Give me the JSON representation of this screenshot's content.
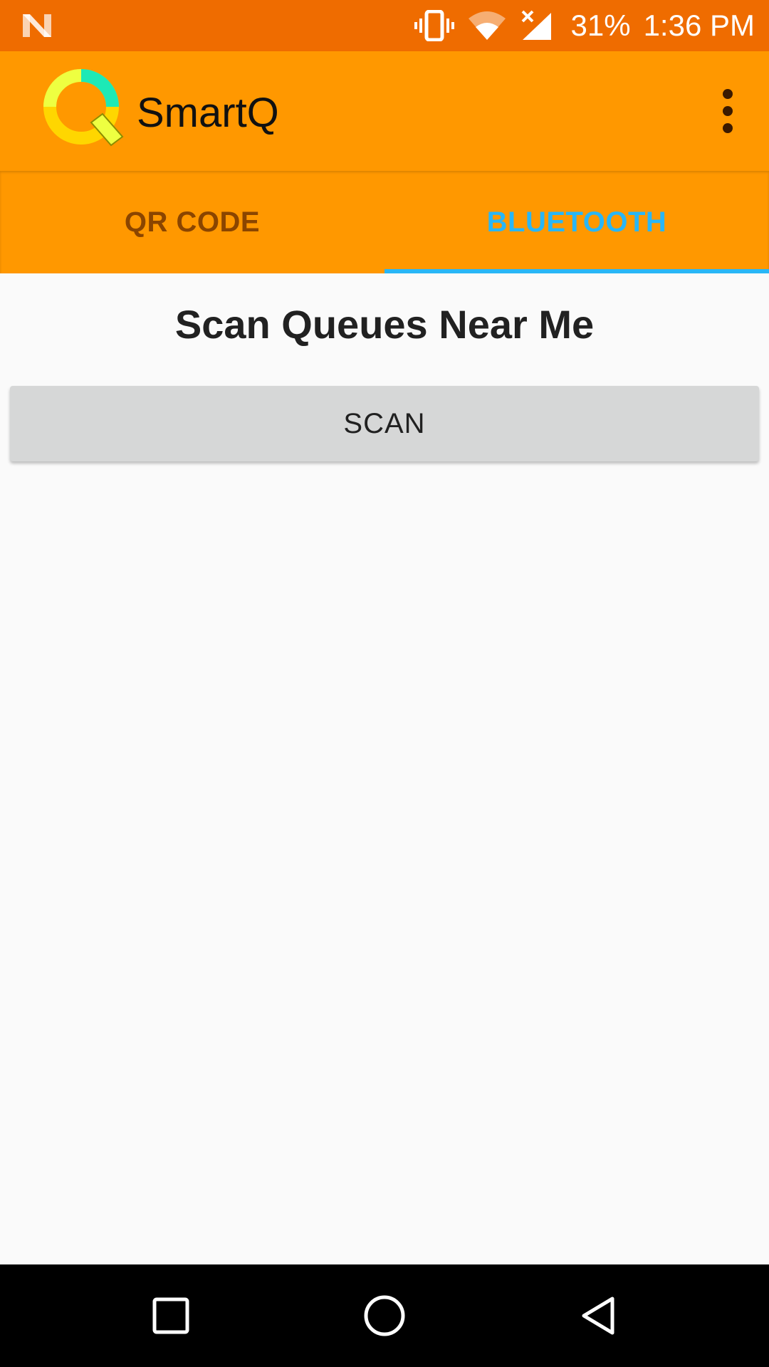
{
  "status_bar": {
    "battery": "31%",
    "time": "1:36 PM",
    "icons": [
      "n-notification-icon",
      "vibrate-icon",
      "wifi-icon",
      "signal-no-data-icon"
    ]
  },
  "app_bar": {
    "title": "SmartQ",
    "logo_icon": "smartq-q-logo",
    "menu_icon": "more-vert-icon"
  },
  "tabs": [
    {
      "label": "QR CODE",
      "selected": false
    },
    {
      "label": "BLUETOOTH",
      "selected": true
    }
  ],
  "main": {
    "heading": "Scan Queues Near Me",
    "scan_button_label": "SCAN"
  },
  "nav_bar": {
    "icons": [
      "recents-square-icon",
      "home-circle-icon",
      "back-triangle-icon"
    ]
  },
  "colors": {
    "status_bar": "#ef6c00",
    "app_bar": "#ff9800",
    "tab_selected": "#29b6f6",
    "tab_unselected": "#8a4500",
    "background": "#fafafa",
    "button": "#d6d7d7"
  }
}
